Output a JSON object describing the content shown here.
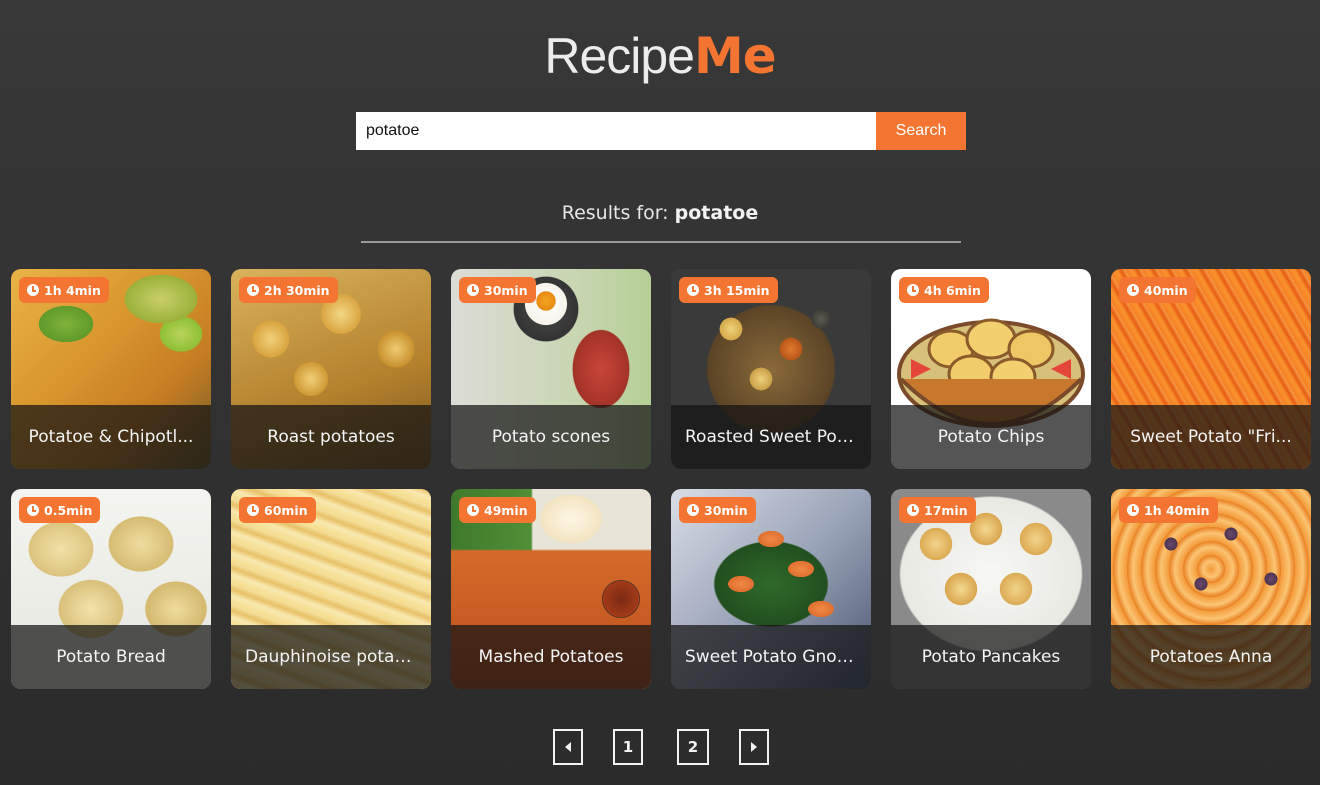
{
  "app": {
    "logo_light": "Recipe",
    "logo_bold": "Me",
    "accent_color": "#f47532"
  },
  "search": {
    "value": "potatoe",
    "placeholder": "",
    "button_label": "Search"
  },
  "results": {
    "prefix": "Results for:",
    "query": "potatoe"
  },
  "recipes": [
    {
      "title": "Potatoe & Chipotl...",
      "time": "1h 4min"
    },
    {
      "title": "Roast potatoes",
      "time": "2h 30min"
    },
    {
      "title": "Potato scones",
      "time": "30min"
    },
    {
      "title": "Roasted Sweet Pot...",
      "time": "3h 15min"
    },
    {
      "title": "Potato Chips",
      "time": "4h 6min"
    },
    {
      "title": "Sweet Potato \"Fri...",
      "time": "40min"
    },
    {
      "title": "Potato Bread",
      "time": "0.5min"
    },
    {
      "title": "Dauphinoise potat...",
      "time": "60min"
    },
    {
      "title": "Mashed Potatoes",
      "time": "49min"
    },
    {
      "title": "Sweet Potato Gnoc...",
      "time": "30min"
    },
    {
      "title": "Potato Pancakes",
      "time": "17min"
    },
    {
      "title": "Potatoes Anna",
      "time": "1h 40min"
    }
  ],
  "pagination": {
    "pages": [
      "1",
      "2"
    ],
    "prev_icon": "caret-left-icon",
    "next_icon": "caret-right-icon"
  }
}
